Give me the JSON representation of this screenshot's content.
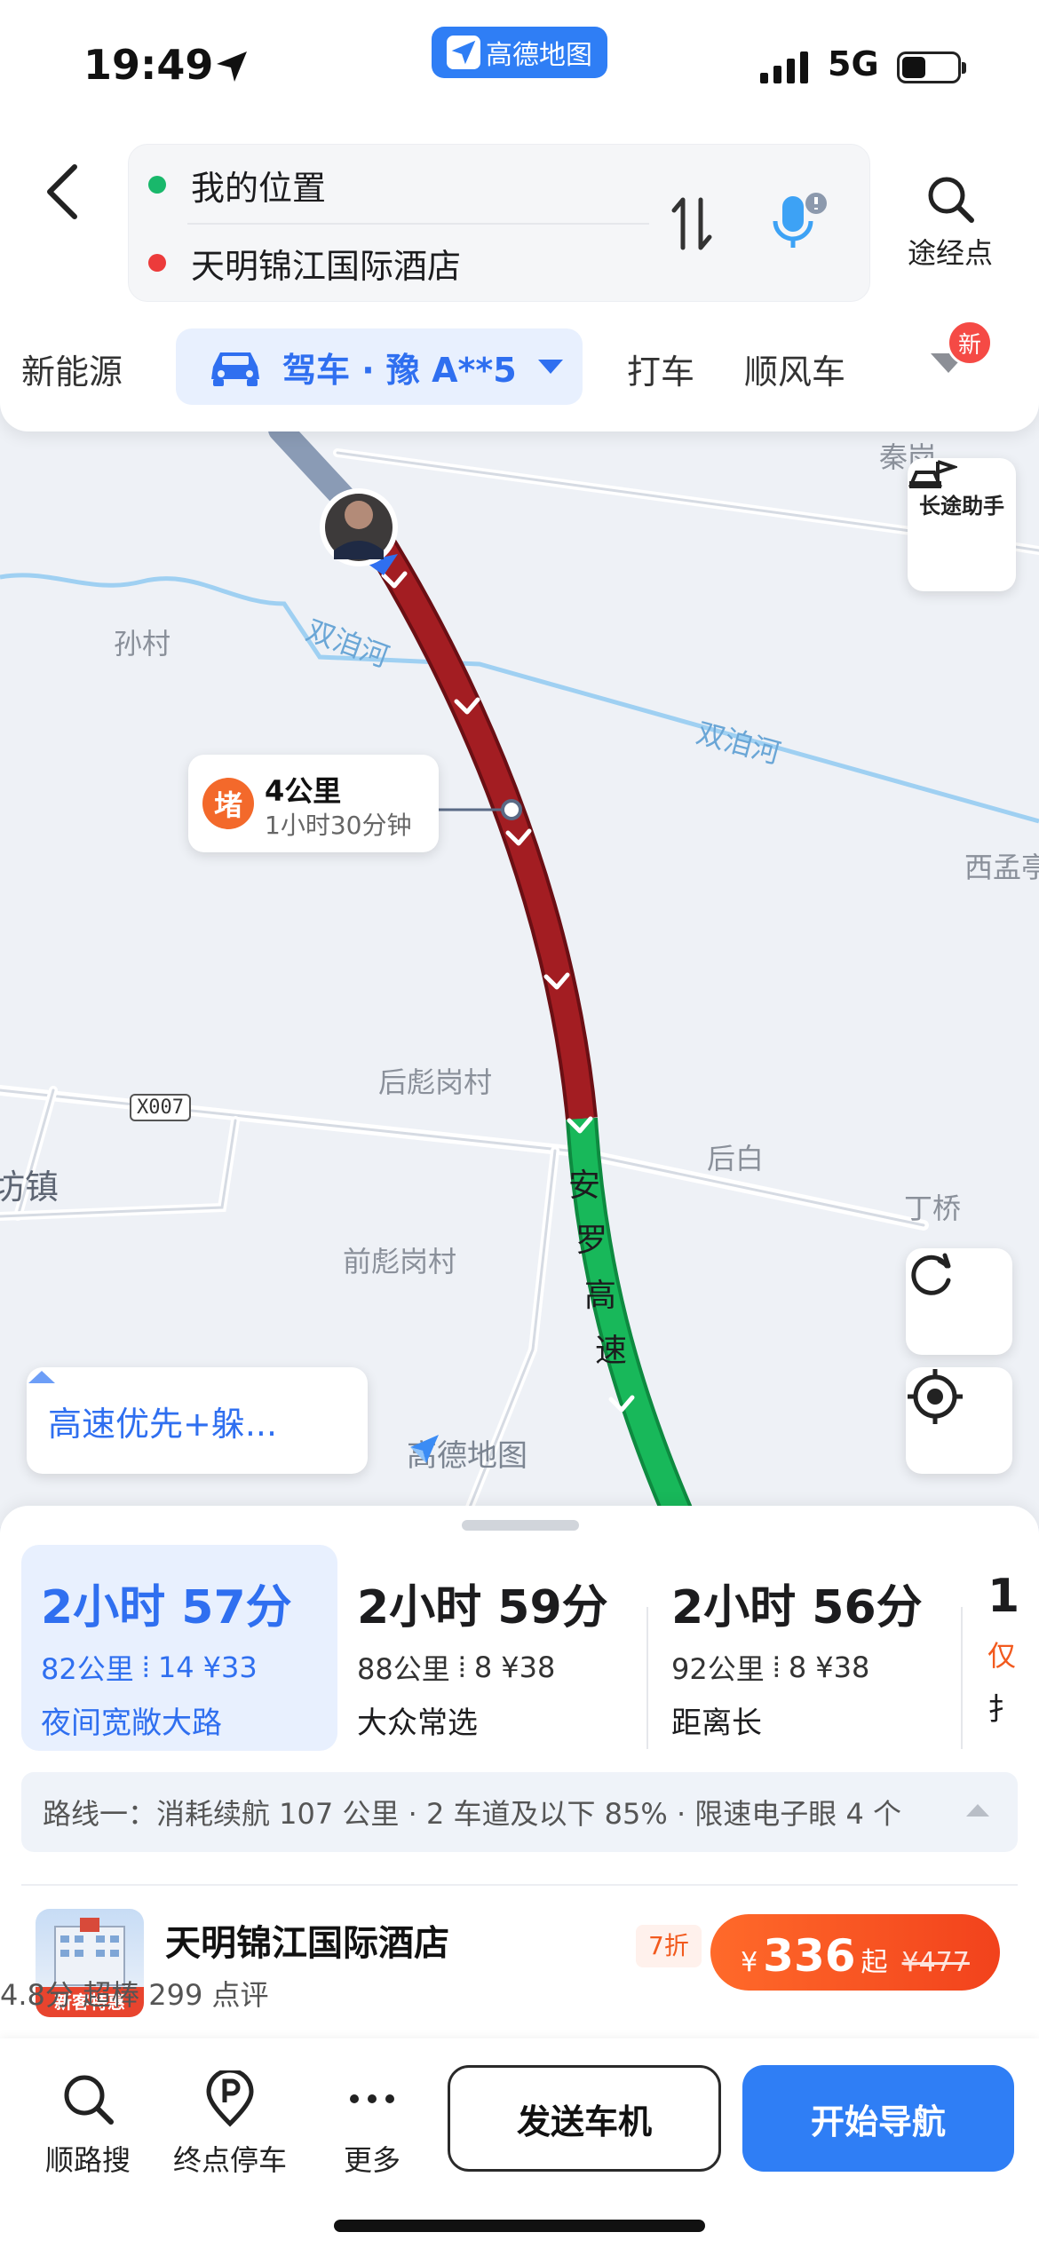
{
  "status_bar": {
    "time": "19:49",
    "network": "5G"
  },
  "app_badge": {
    "label": "高德地图"
  },
  "search": {
    "origin": "我的位置",
    "destination": "天明锦江国际酒店",
    "waypoint_label": "途经点",
    "colors": {
      "origin_dot": "#19b86b",
      "destination_dot": "#ec3b3b"
    }
  },
  "mode_tabs": {
    "new_energy": "新能源",
    "drive": "驾车 · 豫 A**5",
    "taxi": "打车",
    "carpool": "顺风车",
    "new_badge": "新"
  },
  "map": {
    "labels": {
      "qin": "秦岗",
      "suncun": "孙村",
      "river1": "双洎河",
      "river2": "双洎河",
      "ximeng": "西孟亭",
      "houbiao": "后彪岗村",
      "houbai": "后白",
      "zhen": "坊镇",
      "qianbiao": "前彪岗村",
      "dingqiao": "丁桥",
      "road_code": "X007",
      "highway": [
        "安",
        "罗",
        "高",
        "速"
      ]
    },
    "long_trip_label": "长途助手",
    "jam": {
      "icon_text": "堵",
      "distance": "4公里",
      "duration": "1小时30分钟"
    },
    "route_preference": "高速优先+躲...",
    "watermark": "高德地图",
    "colors": {
      "congestion": "#a31d22",
      "smooth": "#18b85a",
      "water": "#9fd0f2"
    }
  },
  "routes": [
    {
      "time": "2小时 57分",
      "distance": "82公里",
      "lights": "14",
      "toll": "¥33",
      "tag": "夜间宽敞大路",
      "selected": true
    },
    {
      "time": "2小时 59分",
      "distance": "88公里",
      "lights": "8",
      "toll": "¥38",
      "tag": "大众常选",
      "selected": false
    },
    {
      "time": "2小时 56分",
      "distance": "92公里",
      "lights": "8",
      "toll": "¥38",
      "tag": "距离长",
      "selected": false
    },
    {
      "time": "1",
      "distance": "仅",
      "lights": "",
      "toll": "",
      "tag": "扌",
      "selected": false
    }
  ],
  "route_info": "路线一：消耗续航 107 公里 · 2 车道及以下 85% · 限速电子眼 4 个",
  "hotel": {
    "name": "天明锦江国际酒店",
    "rating": "4.8分  超棒  299 点评",
    "image_tag": "新客特惠",
    "discount": "7折",
    "price_currency": "¥",
    "price": "336",
    "price_suffix": "起",
    "original_price": "¥477"
  },
  "bottom_bar": {
    "search_along": "顺路搜",
    "parking": "终点停车",
    "more": "更多",
    "send_car": "发送车机",
    "start_nav": "开始导航"
  }
}
